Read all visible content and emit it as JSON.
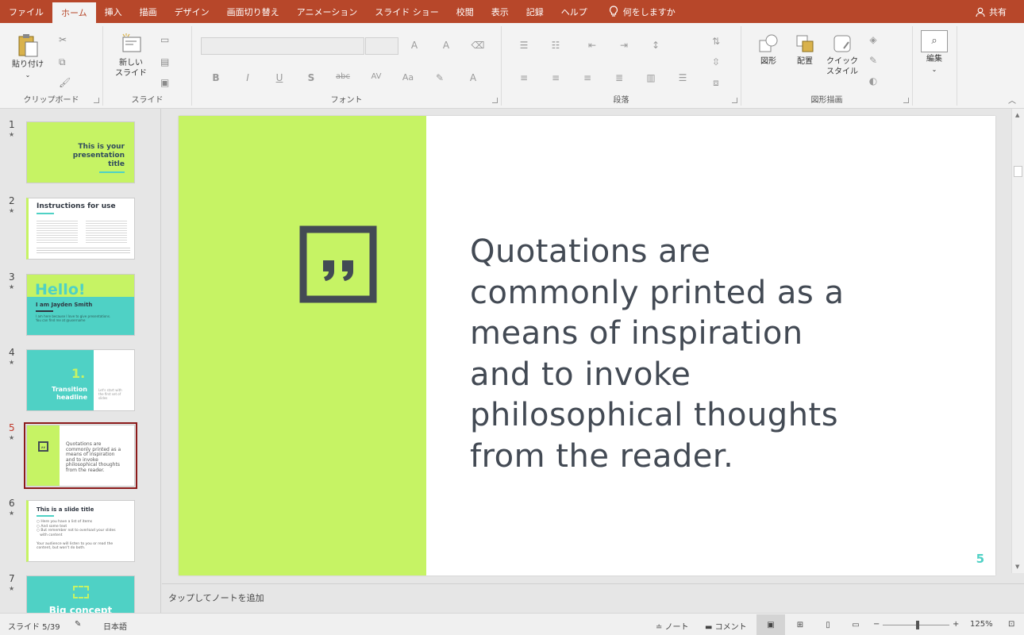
{
  "tabs": [
    "ファイル",
    "ホーム",
    "挿入",
    "描画",
    "デザイン",
    "画面切り替え",
    "アニメーション",
    "スライド ショー",
    "校閲",
    "表示",
    "記録",
    "ヘルプ"
  ],
  "tell_me": "何をしますか",
  "share": "共有",
  "ribbon": {
    "paste": "貼り付け",
    "clipboard": "クリップボード",
    "new_slide_1": "新しい",
    "new_slide_2": "スライド",
    "slides": "スライド",
    "font": "フォント",
    "paragraph": "段落",
    "shapes": "図形",
    "arrange": "配置",
    "quick_style_1": "クイック",
    "quick_style_2": "スタイル",
    "drawing": "図形描画",
    "edit": "編集",
    "bold": "B",
    "italic": "I",
    "underline": "U",
    "shadow": "S",
    "strike": "abc",
    "spacing": "AV",
    "case": "Aa",
    "font_color": "A"
  },
  "thumbnails": [
    {
      "num": "1",
      "title_1": "This is your",
      "title_2": "presentation",
      "title_3": "title"
    },
    {
      "num": "2",
      "title": "Instructions for use"
    },
    {
      "num": "3",
      "hello": "Hello!",
      "name": "I am Jayden Smith",
      "sub_1": "I am here because I love to give presentations.",
      "sub_2": "You can find me at @username"
    },
    {
      "num": "4",
      "number": "1.",
      "head_1": "Transition",
      "head_2": "headline",
      "side_1": "Let's start with",
      "side_2": "the first set of",
      "side_3": "slides"
    },
    {
      "num": "5",
      "q1": "Quotations are",
      "q2": "commonly printed as a",
      "q3": "means of inspiration",
      "q4": "and to invoke",
      "q5": "philosophical thoughts",
      "q6": "from the reader."
    },
    {
      "num": "6",
      "title": "This is a slide title",
      "b1": "Here you have a list of items",
      "b2": "And some text",
      "b3": "But remember not to overload your slides",
      "b4": "with content",
      "p1": "Your audience will listen to you or read the",
      "p2": "content, but won't do both."
    },
    {
      "num": "7",
      "title": "Big concept"
    }
  ],
  "slide": {
    "lines": [
      "Quotations are",
      "commonly printed as a",
      "means of inspiration",
      "and to invoke",
      "philosophical thoughts",
      "from the reader."
    ],
    "page": "5"
  },
  "notes_placeholder": "タップしてノートを追加",
  "status": {
    "slide_count": "スライド 5/39",
    "language": "日本語",
    "notes": "ノート",
    "comments": "コメント",
    "zoom": "125%"
  },
  "colors": {
    "accent": "#b7472a",
    "lime": "#c6f364",
    "teal": "#4fd1c5",
    "text": "#434a54"
  }
}
